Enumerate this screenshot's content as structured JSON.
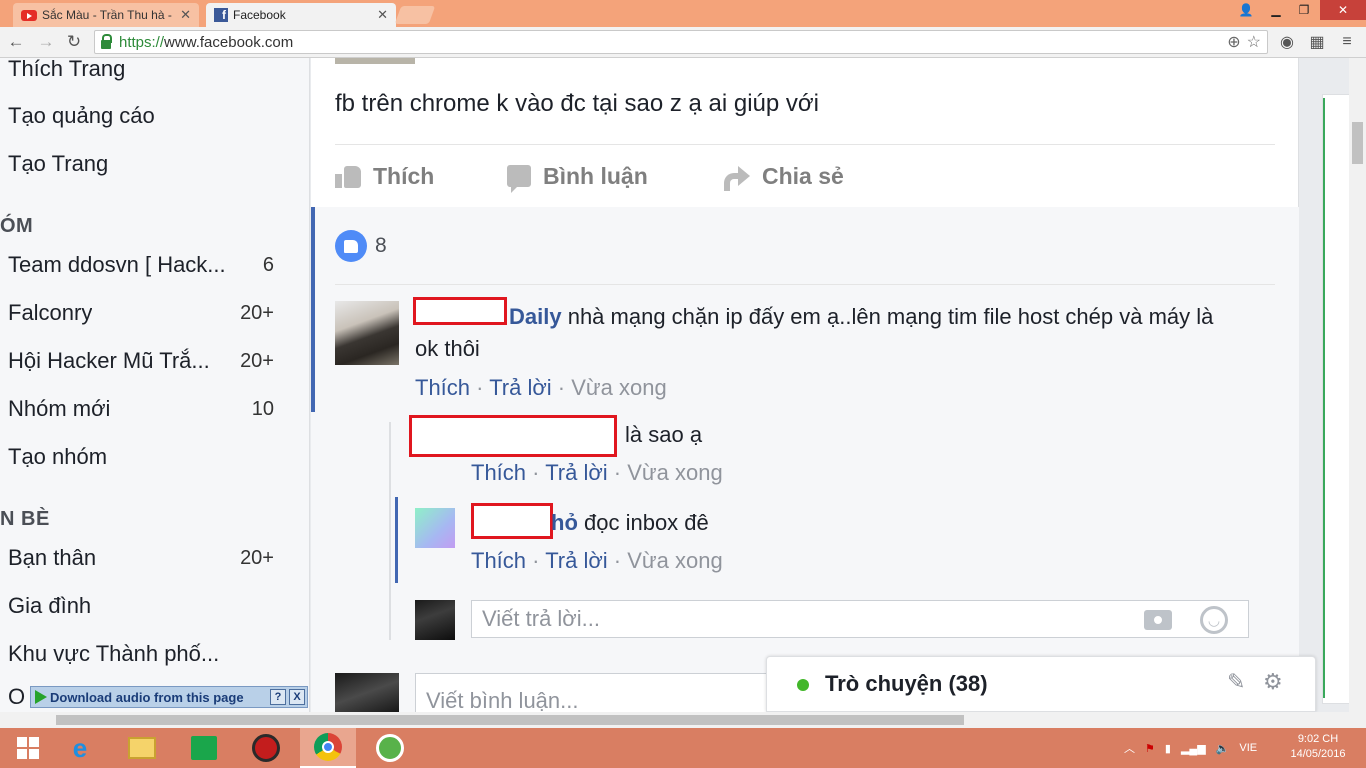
{
  "browser": {
    "tabs": [
      {
        "title": "Sắc Màu - Trần Thu hà - Y",
        "icon": "youtube-icon",
        "active": false
      },
      {
        "title": "Facebook",
        "icon": "facebook-icon",
        "active": true
      }
    ],
    "url_scheme": "https://",
    "url_host": "www.facebook.com"
  },
  "sidebar": {
    "pages_items": [
      {
        "label": "Thích Trang"
      },
      {
        "label": "Tạo quảng cáo"
      },
      {
        "label": "Tạo Trang"
      }
    ],
    "groups_heading": "ÓM",
    "groups": [
      {
        "label": "Team ddosvn [ Hack...",
        "count": "6"
      },
      {
        "label": "Falconry",
        "count": "20+"
      },
      {
        "label": "Hội Hacker Mũ Trắ...",
        "count": "20+"
      },
      {
        "label": "Nhóm mới",
        "count": "10"
      },
      {
        "label": "Tạo nhóm",
        "count": ""
      }
    ],
    "friends_heading": "N BÈ",
    "friends": [
      {
        "label": "Bạn thân",
        "count": "20+"
      },
      {
        "label": "Gia đình",
        "count": ""
      },
      {
        "label": "Khu vực Thành phố...",
        "count": ""
      }
    ],
    "cut_off_item": "O"
  },
  "post": {
    "text": "fb trên chrome k vào đc tại sao z ạ ai giúp với",
    "actions": {
      "like": "Thích",
      "comment": "Bình luận",
      "share": "Chia sẻ"
    },
    "like_count": "8",
    "comments": [
      {
        "name_visible": "Daily",
        "text": " nhà mạng chặn ip đấy em ạ..lên mạng tim file host chép và máy là ok thôi",
        "like": "Thích",
        "reply": "Trả lời",
        "time": "Vừa xong",
        "replies": [
          {
            "name_visible": "",
            "text": "là sao ạ",
            "like": "Thích",
            "reply": "Trả lời",
            "time": "Vừa xong"
          },
          {
            "name_visible": "hỏ",
            "text": " đọc inbox đê",
            "like": "Thích",
            "reply": "Trả lời",
            "time": "Vừa xong"
          }
        ]
      }
    ],
    "reply_placeholder": "Viết trả lời...",
    "comment_placeholder": "Viết bình luận..."
  },
  "chat": {
    "title": "Trò chuyện (38)",
    "status_color": "#42b72a"
  },
  "download_bar": {
    "label": "Download audio from this page",
    "help": "?",
    "close": "X"
  },
  "taskbar": {
    "language": "VIE",
    "time": "9:02 CH",
    "date": "14/05/2016"
  },
  "colors": {
    "fb_blue": "#365899",
    "titlebar": "#f4a37a",
    "taskbar": "#d97e62",
    "redaction": "#e0161f"
  }
}
